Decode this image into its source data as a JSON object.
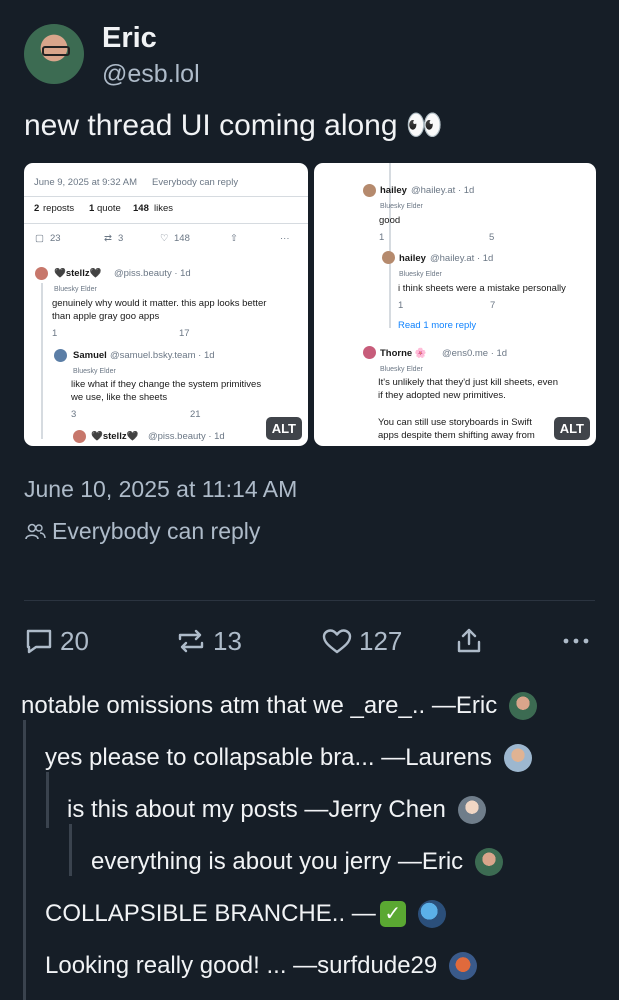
{
  "post": {
    "display_name": "Eric",
    "handle": "@esb.lol",
    "text": "new thread UI coming along 👀",
    "date": "June 10, 2025 at 11:14 AM",
    "reply_setting": "Everybody can reply"
  },
  "images": [
    {
      "alt_badge": "ALT",
      "top_date": "June 9, 2025 at 9:32 AM",
      "top_reply": "Everybody can reply",
      "reposts": "2",
      "reposts_label": "reposts",
      "quotes": "1",
      "quotes_label": "quote",
      "likes": "148",
      "likes_label": "likes",
      "stat_replies": "23",
      "stat_reposts": "3",
      "stat_likes": "148",
      "p1_name": "🖤stellz🖤",
      "p1_handle": "@piss.beauty · 1d",
      "p1_badge": "Bluesky Elder",
      "p1_text1": "genuinely why would it matter. this app looks better",
      "p1_text2": "than apple gray goo apps",
      "p1_replies": "1",
      "p1_likes": "17",
      "p2_name": "Samuel",
      "p2_handle": "@samuel.bsky.team · 1d",
      "p2_badge": "Bluesky Elder",
      "p2_text1": "like what if they change the system primitives",
      "p2_text2": "we use, like the sheets",
      "p2_replies": "3",
      "p2_likes": "21",
      "p3_name": "🖤stellz🖤",
      "p3_handle": "@piss.beauty · 1d"
    },
    {
      "alt_badge": "ALT",
      "q1_name": "hailey",
      "q1_handle": "@hailey.at · 1d",
      "q1_badge": "Bluesky Elder",
      "q1_text": "good",
      "q1_replies": "1",
      "q1_likes": "5",
      "q2_name": "hailey",
      "q2_handle": "@hailey.at · 1d",
      "q2_badge": "Bluesky Elder",
      "q2_text": "i think sheets were a mistake personally",
      "q2_replies": "1",
      "q2_likes": "7",
      "read_more": "Read 1 more reply",
      "q3_name": "Thorne 🌸",
      "q3_handle": "@ens0.me · 1d",
      "q3_badge": "Bluesky Elder",
      "q3_text1": "It's unlikely that they'd just kill sheets, even",
      "q3_text2": "if they adopted new primitives.",
      "q3_text3": "You can still use storyboards in Swift",
      "q3_text4": "apps despite them shifting away from"
    }
  ],
  "actions": {
    "replies": "20",
    "reposts": "13",
    "likes": "127"
  },
  "thread": [
    {
      "text": "notable omissions atm that we _are_.. —Eric"
    },
    {
      "text": "yes please to collapsable bra... —Laurens"
    },
    {
      "text": "is this about my posts —Jerry Chen"
    },
    {
      "text": "everything is about you jerry —Eric"
    },
    {
      "text": "COLLAPSIBLE BRANCHE.. —"
    },
    {
      "text": "Looking really good! ...   —surfdude29"
    }
  ],
  "colors": {
    "background": "#161e27",
    "secondary_text": "#aebbc9",
    "accent": "#1083fe"
  }
}
